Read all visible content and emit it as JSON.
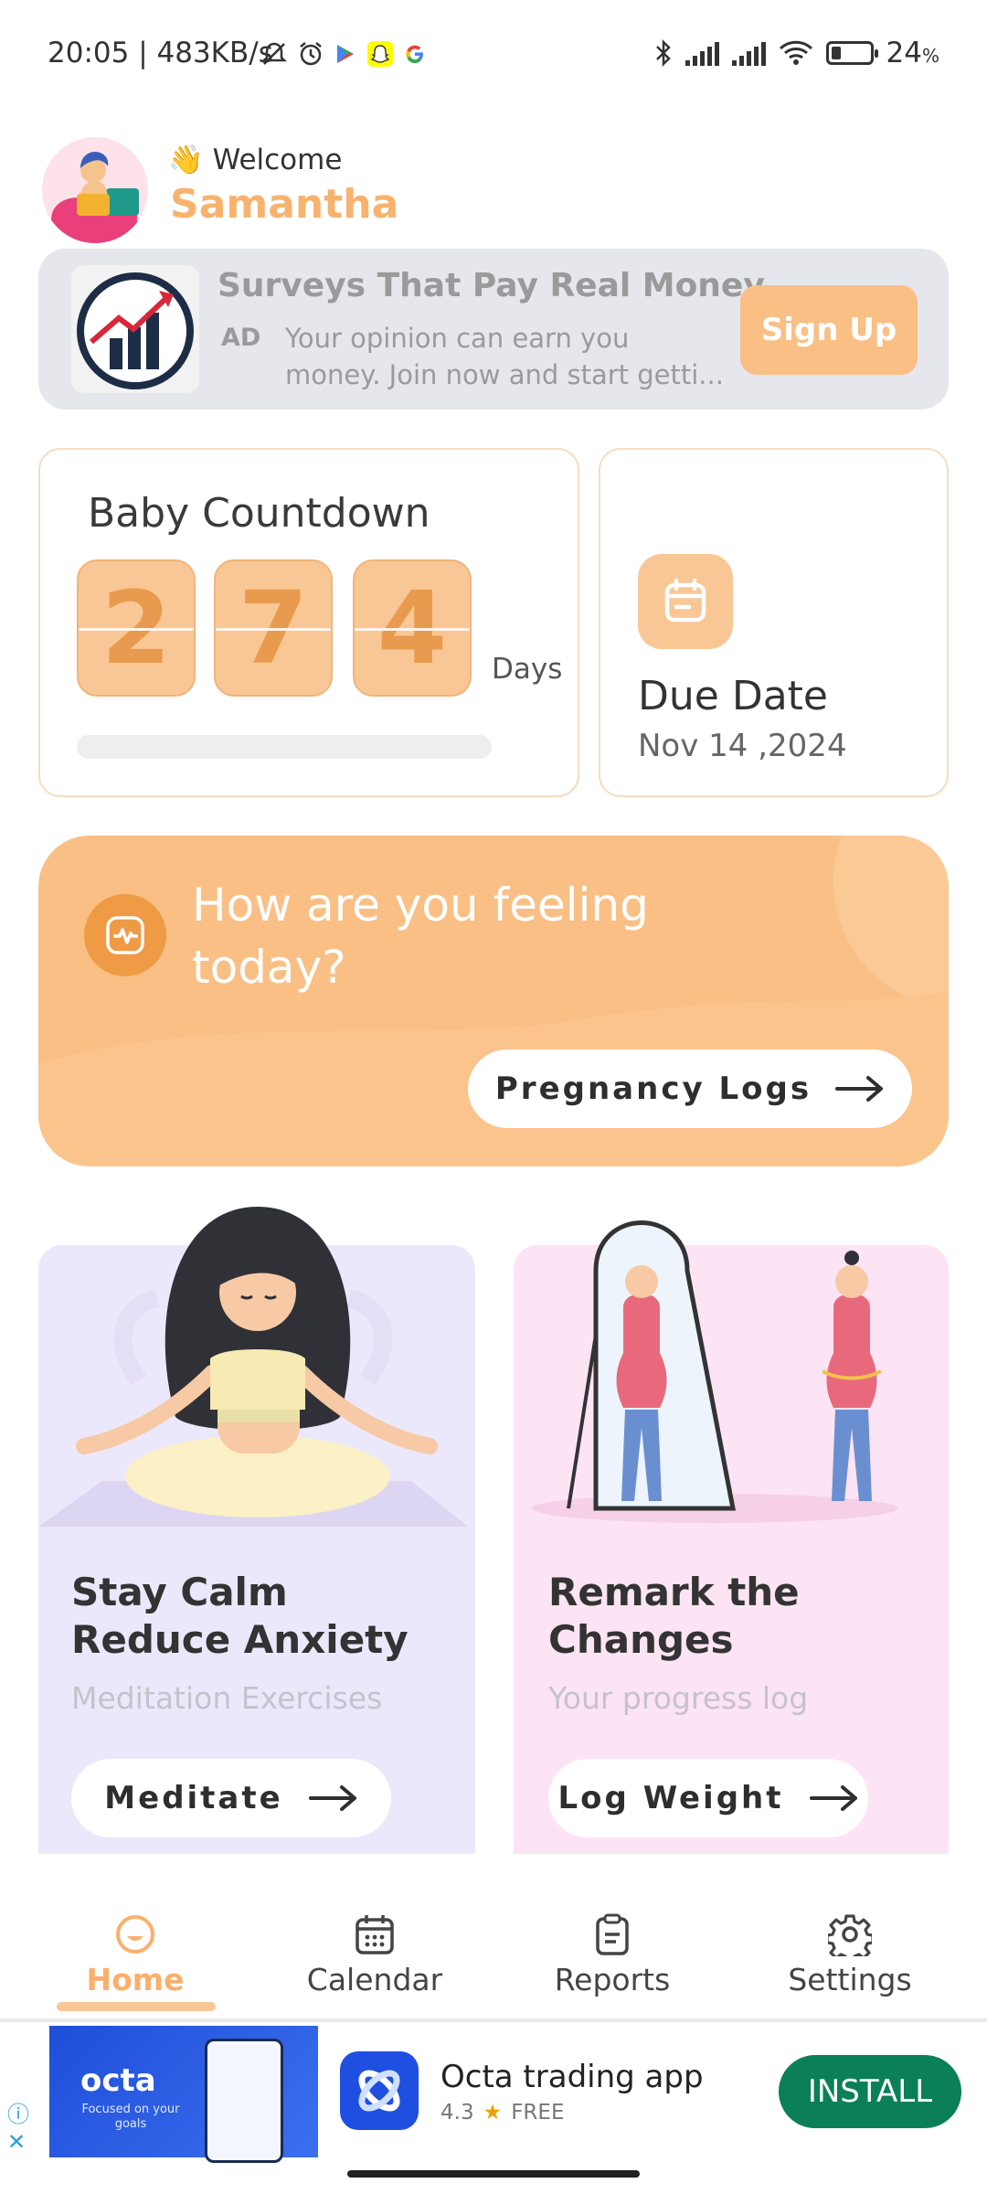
{
  "status_bar": {
    "time": "20:05",
    "speed": "483KB/s",
    "battery": "24",
    "battery_unit": "%",
    "icons_left": [
      "mute-icon",
      "alarm-icon",
      "play-store-icon",
      "snapchat-icon",
      "google-icon"
    ],
    "icons_right": [
      "bluetooth-icon",
      "signal-icon",
      "signal-icon",
      "wifi-icon",
      "battery-icon"
    ]
  },
  "header": {
    "welcome_emoji": "👋",
    "welcome": "Welcome",
    "user_name": "Samantha"
  },
  "ad_banner": {
    "title": "Surveys That Pay Real Money",
    "label": "AD",
    "description": "Your opinion can earn you money. Join now and start getti...",
    "cta": "Sign Up"
  },
  "countdown": {
    "title": "Baby Countdown",
    "digits": [
      "2",
      "7",
      "4"
    ],
    "unit": "Days",
    "progress": 0
  },
  "due_date": {
    "title": "Due Date",
    "date": "Nov 14 ,2024"
  },
  "feeling": {
    "question": "How are you feeling today?",
    "button": "Pregnancy Logs"
  },
  "features": [
    {
      "title": "Stay Calm\nReduce Anxiety",
      "subtitle": "Meditation Exercises",
      "button": "Meditate"
    },
    {
      "title": "Remark the\nChanges",
      "subtitle": "Your progress log",
      "button": "Log Weight"
    }
  ],
  "bottom_nav": {
    "active": "Home",
    "items": [
      {
        "label": "Home",
        "icon": "home-smile-icon"
      },
      {
        "label": "Calendar",
        "icon": "calendar-icon"
      },
      {
        "label": "Reports",
        "icon": "reports-icon"
      },
      {
        "label": "Settings",
        "icon": "settings-gear-icon"
      }
    ]
  },
  "bottom_ad": {
    "brand": "octa",
    "tagline": "Focused on your goals",
    "app_name": "Octa trading app",
    "rating": "4.3",
    "price": "FREE",
    "cta": "INSTALL"
  },
  "colors": {
    "accent": "#f9bf85",
    "accent_dark": "#ef9b45",
    "install_green": "#0b7f57"
  }
}
